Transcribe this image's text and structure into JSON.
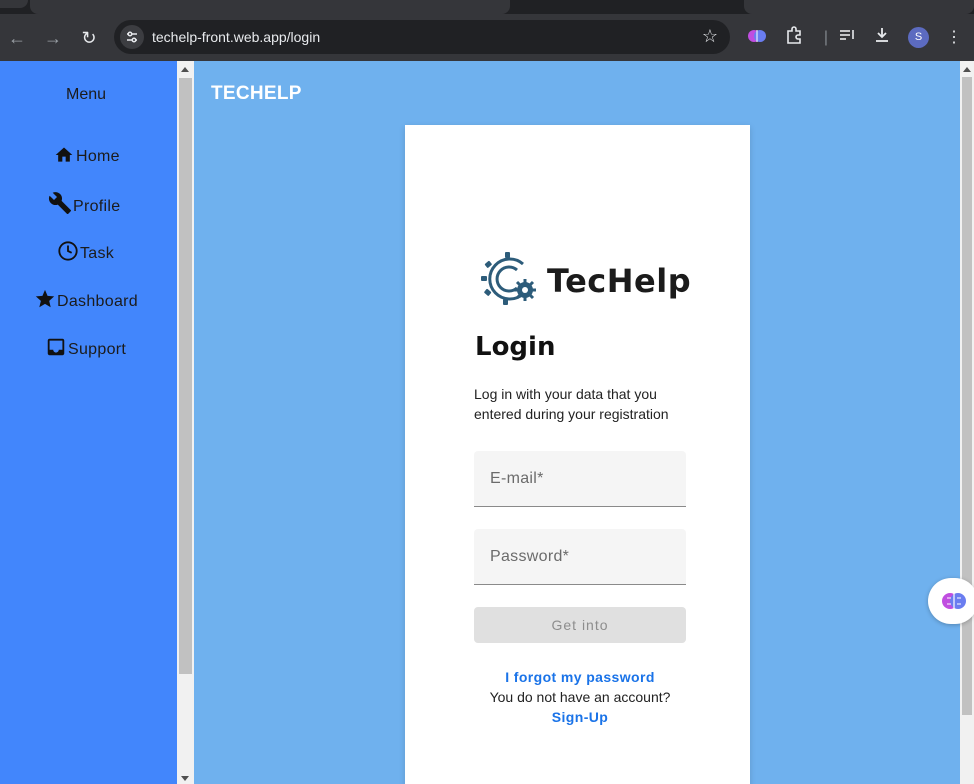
{
  "browser": {
    "url": "techelp-front.web.app/login",
    "profile_initial": "S"
  },
  "sidebar": {
    "title": "Menu",
    "items": [
      {
        "label": "Home",
        "icon": "home-icon"
      },
      {
        "label": "Profile",
        "icon": "wrench-icon"
      },
      {
        "label": "Task",
        "icon": "clock-icon"
      },
      {
        "label": "Dashboard",
        "icon": "star-icon"
      },
      {
        "label": "Support",
        "icon": "inbox-icon"
      }
    ]
  },
  "header": {
    "brand": "TECHELP"
  },
  "login": {
    "logo_text": "TecHelp",
    "title": "Login",
    "description": "Log in with your data that you entered during your registration",
    "email_placeholder": "E-mail*",
    "password_placeholder": "Password*",
    "submit_label": "Get into",
    "forgot_link": "I forgot my password",
    "no_account_text": "You do not have an account?",
    "signup_link": "Sign-Up"
  },
  "colors": {
    "sidebar_bg": "#4286fc",
    "page_bg": "#6fb1ee",
    "link": "#1a73e8"
  }
}
